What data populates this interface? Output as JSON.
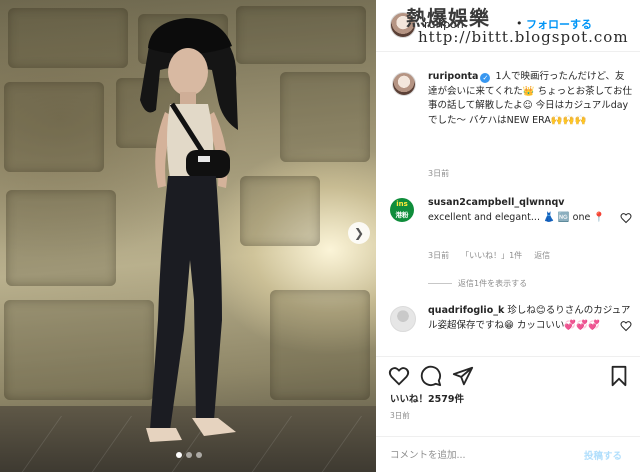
{
  "header": {
    "username": "ruripon",
    "separator": "•",
    "follow_label": "フォローする"
  },
  "watermark": {
    "title": "熱爆娛樂",
    "url": "http://bittt.blogspot.com"
  },
  "caption": {
    "username": "ruriponta",
    "text": "1人で映画行ったんだけど、友達が会いに来てくれた👑 ちょっとお茶してお仕事の話して解散したよ☺ 今日はカジュアルdayでした〜 バケハはNEW ERA🙌🙌🙌",
    "time": "3日前"
  },
  "comments": [
    {
      "username": "susan2campbell_qlwnnqv",
      "text": "excellent and elegant... 👗 🆖 one 📍",
      "time": "3日前",
      "likes": "「いいね！」1件",
      "reply_label": "返信",
      "view_replies": "返信1件を表示する",
      "avatar_top": "ins",
      "avatar_sub": "港粉"
    },
    {
      "username": "quadrifoglio_k",
      "text": "珍しね😊るりさんのカジュアル姿超保存ですね😁 カッコいい💞💞💞"
    }
  ],
  "actions": {
    "likes": "いいね！2579件",
    "time": "3日前"
  },
  "add_comment": {
    "placeholder": "コメントを追加...",
    "post_label": "投稿する"
  },
  "carousel": {
    "slide_count": 3,
    "active_index": 0
  },
  "colors": {
    "link_blue": "#0095f6",
    "post_disabled": "#b2dffc",
    "verified": "#3897f0",
    "heart_red": "#ed4956"
  }
}
